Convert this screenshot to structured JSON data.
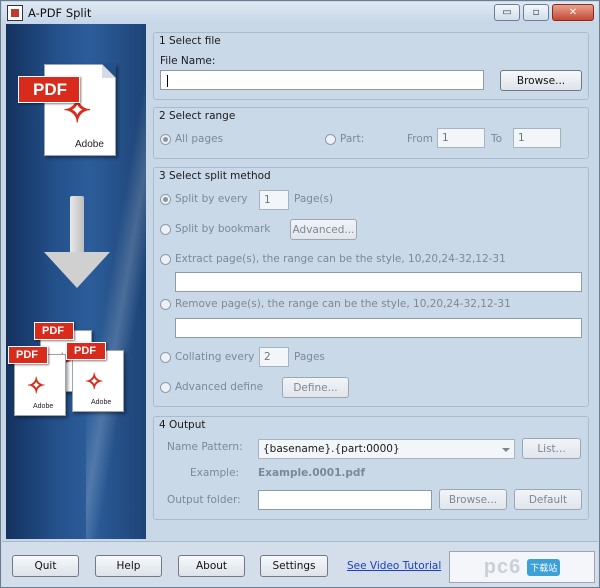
{
  "window": {
    "title": "A-PDF Split",
    "minimize": "▭",
    "restore": "▫",
    "close": "✕"
  },
  "side": {
    "pdf_label": "PDF",
    "adobe_label": "Adobe"
  },
  "group1": {
    "title": "1 Select file",
    "file_label": "File Name:",
    "file_value": "",
    "browse": "Browse..."
  },
  "group2": {
    "title": "2 Select range",
    "all_pages": "All pages",
    "part": "Part:",
    "from": "From",
    "from_value": "1",
    "to": "To",
    "to_value": "1"
  },
  "group3": {
    "title": "3 Select split method",
    "split_every": "Split by every",
    "split_every_value": "1",
    "pages_unit": "Page(s)",
    "bookmark": "Split by bookmark",
    "advanced_btn": "Advanced...",
    "extract": "Extract page(s), the range can be the style, 10,20,24-32,12-31",
    "extract_value": "",
    "remove": "Remove page(s), the range can be the style, 10,20,24-32,12-31",
    "remove_value": "",
    "collating": "Collating every",
    "collating_value": "2",
    "collating_unit": "Pages",
    "advanced_define": "Advanced define",
    "define_btn": "Define..."
  },
  "group4": {
    "title": "4 Output",
    "name_pattern_label": "Name Pattern:",
    "name_pattern_value": "{basename}.{part:0000}",
    "list_btn": "List...",
    "example_label": "Example:",
    "example_value": "Example.0001.pdf",
    "output_folder_label": "Output folder:",
    "output_folder_value": "",
    "browse_btn": "Browse...",
    "default_btn": "Default"
  },
  "bottom": {
    "quit": "Quit",
    "help": "Help",
    "about": "About",
    "settings": "Settings",
    "video_tutorial": "See Video Tutorial",
    "watermark_logo": "pc6",
    "watermark_badge": "下载站"
  },
  "colors": {
    "accent": "#24508a",
    "pdf_red": "#d92b1c",
    "link": "#1a3fc4"
  }
}
